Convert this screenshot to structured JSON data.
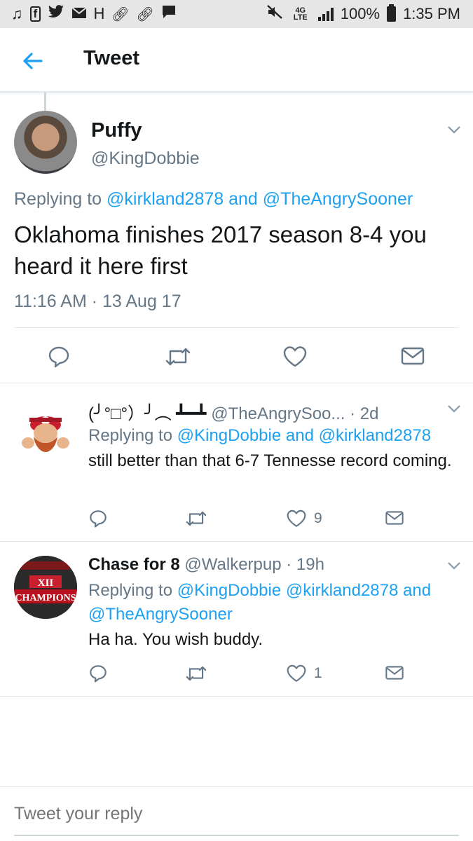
{
  "status_bar": {
    "left_icons": [
      "music-note-icon",
      "facebook-icon",
      "twitter-icon",
      "mail-icon",
      "h-app-icon",
      "link-icon",
      "link-icon",
      "chat-icon"
    ],
    "network": "4G LTE",
    "battery": "100%",
    "time": "1:35 PM"
  },
  "app_bar": {
    "title": "Tweet"
  },
  "main_tweet": {
    "name": "Puffy",
    "handle": "@KingDobbie",
    "replying_prefix": "Replying to",
    "replying_a": "@kirkland2878",
    "replying_and": "and",
    "replying_b": "@TheAngrySooner",
    "text": "Oklahoma finishes 2017 season 8-4 you heard it here first",
    "timestamp": "11:16 AM · 13 Aug 17"
  },
  "replies": [
    {
      "name": "(╯°□°）╯︵ ┻━┻",
      "handle": "@TheAngrySoo...",
      "age": "· 2d",
      "replying_prefix": "Replying to",
      "replying_a": "@KingDobbie",
      "replying_and": "and",
      "replying_b": "@kirkland2878",
      "text": "still better than that 6-7 Tennesse record coming.",
      "like_count": "9"
    },
    {
      "name": "Chase for 8",
      "handle": "@Walkerpup",
      "age": "· 19h",
      "replying_prefix": "Replying to",
      "replying_a": "@KingDobbie",
      "replying_b": "@kirkland2878",
      "replying_and": "and",
      "replying_c": "@TheAngrySooner",
      "text": "Ha ha. You wish buddy.",
      "like_count": "1",
      "avatar_text_top": "XII",
      "avatar_text": "CHAMPIONS"
    }
  ],
  "composer": {
    "placeholder": "Tweet your reply"
  },
  "colors": {
    "link": "#1da1f2",
    "muted": "#657786",
    "text": "#14171a",
    "divider": "#e1e8ed"
  }
}
